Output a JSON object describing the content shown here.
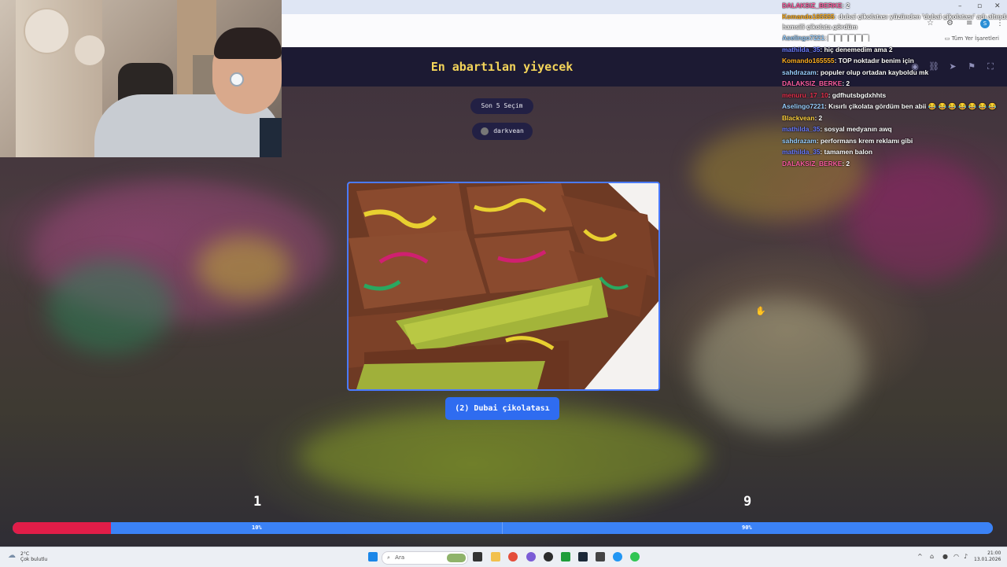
{
  "header": {
    "title": "En abartılan yiyecek"
  },
  "controls": {
    "last_choices": "Son 5 Seçim",
    "user": "darkvean"
  },
  "question": {
    "answer_label": "(2) Dubai çikolatası"
  },
  "scores": {
    "left": "1",
    "right": "9",
    "left_pct_label": "10%",
    "right_pct_label": "90%",
    "left_fraction": 0.1,
    "right_fraction": 0.9
  },
  "colors": {
    "title": "#f3d45a",
    "left_bar": "#e11d48",
    "right_bar": "#3b82f6",
    "answer_button": "#2f6cf0",
    "header_bg": "#1c1a33"
  },
  "browser": {
    "bookmarks_label": "Tüm Yer İşaretleri",
    "win_controls": [
      "–",
      "▫",
      "✕"
    ]
  },
  "chat": {
    "messages": [
      {
        "user": "DALAKSIZ_BERKE",
        "text": ": 2",
        "color": "#ff5fa2"
      },
      {
        "user": "Komando165555",
        "text": ": dubai çikolatası yüzünden 'dubai çikolatası' adı altında",
        "color": "#ffb020"
      },
      {
        "user": "",
        "text": "hamsili çikolata gördüm",
        "color": "#ffffff"
      },
      {
        "user": "Aselingo7221",
        "text": ": ▇ ▇ ▇ ▇ ▇ ▇",
        "color": "#9ad0ff"
      },
      {
        "user": "mathilda_35",
        "text": ": hiç denemedim ama 2",
        "color": "#6b7cff"
      },
      {
        "user": "Komando165555",
        "text": ": TOP noktadır benim için",
        "color": "#ffb020"
      },
      {
        "user": "sahdrazam",
        "text": ": populer olup ortadan kayboldu mk",
        "color": "#9ad0ff"
      },
      {
        "user": "DALAKSIZ_BERKE",
        "text": ": 2",
        "color": "#ff5fa2"
      },
      {
        "user": "menuru_17_10",
        "text": ": gdfhutsbgdxhhts",
        "color": "#e8324f"
      },
      {
        "user": "Aselingo7221",
        "text": ": Kısırlı çikolata gördüm ben abii 😂 😂 😂 😂 😂 😂 😂",
        "color": "#9ad0ff"
      },
      {
        "user": "Blackvean",
        "text": ": 2",
        "color": "#ffd23f"
      },
      {
        "user": "mathilda_35",
        "text": ": sosyal medyanın awq",
        "color": "#6b7cff"
      },
      {
        "user": "sahdrazam",
        "text": ": performans krem reklamı gibi",
        "color": "#9ad0ff"
      },
      {
        "user": "mathilda_35",
        "text": ": tamamen balon",
        "color": "#6b7cff"
      },
      {
        "user": "DALAKSIZ_BERKE",
        "text": ": 2",
        "color": "#ff5fa2"
      }
    ]
  },
  "taskbar": {
    "weather_temp": "2°C",
    "weather_desc": "Çok bulutlu",
    "search_placeholder": "Ara",
    "time": "21:00",
    "date": "13.01.2026"
  }
}
